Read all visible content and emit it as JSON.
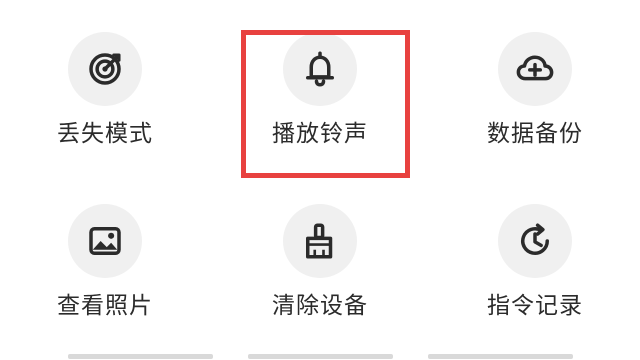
{
  "grid": {
    "row1": [
      {
        "label": "丢失模式",
        "icon": "target-icon"
      },
      {
        "label": "播放铃声",
        "icon": "bell-icon"
      },
      {
        "label": "数据备份",
        "icon": "cloud-add-icon"
      }
    ],
    "row2": [
      {
        "label": "查看照片",
        "icon": "image-icon"
      },
      {
        "label": "清除设备",
        "icon": "broom-icon"
      },
      {
        "label": "指令记录",
        "icon": "history-icon"
      }
    ]
  },
  "colors": {
    "highlight": "#e8413f",
    "icon": "#2b2b2b",
    "icon_bg": "#f0f0f0"
  }
}
